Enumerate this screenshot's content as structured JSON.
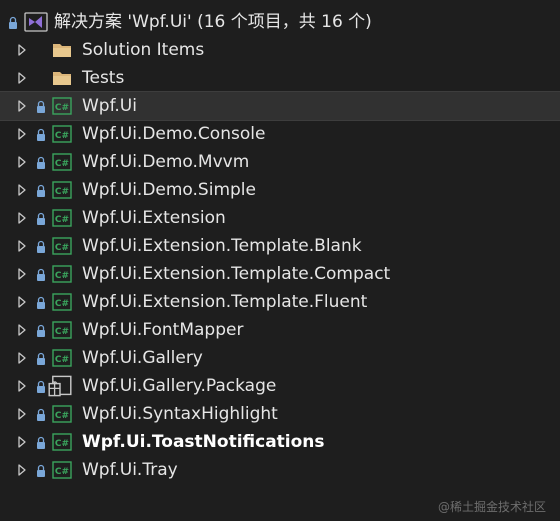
{
  "solution": {
    "label": "解决方案 'Wpf.Ui' (16 个项目，共 16 个)"
  },
  "folders": [
    {
      "label": "Solution Items"
    },
    {
      "label": "Tests"
    }
  ],
  "projects": [
    {
      "label": "Wpf.Ui",
      "icon": "csharp-project-icon",
      "selected": true,
      "bold": false
    },
    {
      "label": "Wpf.Ui.Demo.Console",
      "icon": "csharp-project-icon",
      "selected": false,
      "bold": false
    },
    {
      "label": "Wpf.Ui.Demo.Mvvm",
      "icon": "csharp-project-icon",
      "selected": false,
      "bold": false
    },
    {
      "label": "Wpf.Ui.Demo.Simple",
      "icon": "csharp-project-icon",
      "selected": false,
      "bold": false
    },
    {
      "label": "Wpf.Ui.Extension",
      "icon": "csharp-project-icon",
      "selected": false,
      "bold": false
    },
    {
      "label": "Wpf.Ui.Extension.Template.Blank",
      "icon": "csharp-project-icon",
      "selected": false,
      "bold": false
    },
    {
      "label": "Wpf.Ui.Extension.Template.Compact",
      "icon": "csharp-project-icon",
      "selected": false,
      "bold": false
    },
    {
      "label": "Wpf.Ui.Extension.Template.Fluent",
      "icon": "csharp-project-icon",
      "selected": false,
      "bold": false
    },
    {
      "label": "Wpf.Ui.FontMapper",
      "icon": "csharp-project-icon",
      "selected": false,
      "bold": false
    },
    {
      "label": "Wpf.Ui.Gallery",
      "icon": "csharp-project-icon",
      "selected": false,
      "bold": false
    },
    {
      "label": "Wpf.Ui.Gallery.Package",
      "icon": "package-project-icon",
      "selected": false,
      "bold": false
    },
    {
      "label": "Wpf.Ui.SyntaxHighlight",
      "icon": "csharp-project-icon",
      "selected": false,
      "bold": false
    },
    {
      "label": "Wpf.Ui.ToastNotifications",
      "icon": "csharp-project-icon",
      "selected": false,
      "bold": true
    },
    {
      "label": "Wpf.Ui.Tray",
      "icon": "csharp-project-icon",
      "selected": false,
      "bold": false
    }
  ],
  "watermark": "@稀土掘金技术社区",
  "colors": {
    "background": "#1e1e1e",
    "selected_row": "#313131",
    "folder": "#dcb67a",
    "csharp_icon": "#3aa55d",
    "lock": "#7aa7d8",
    "chevron": "#c8c8c8"
  }
}
